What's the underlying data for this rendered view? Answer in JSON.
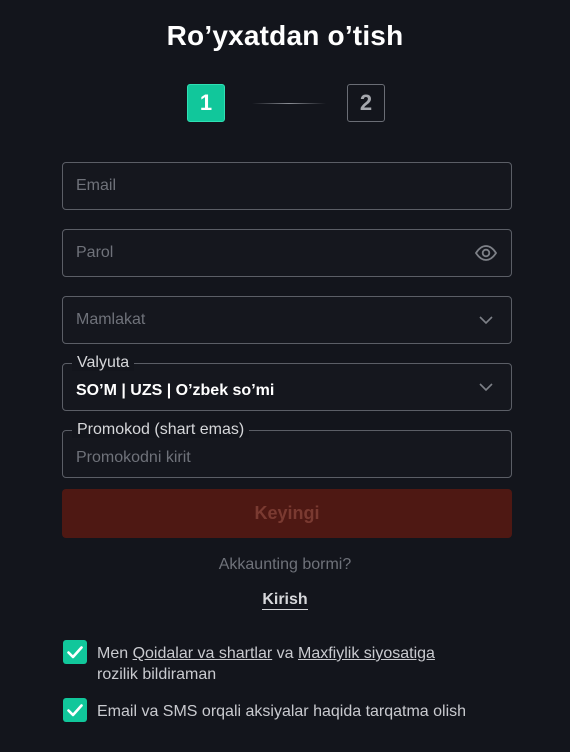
{
  "title": "Ro’yxatdan o’tish",
  "stepper": {
    "step1": "1",
    "step2": "2",
    "active_step": 1
  },
  "form": {
    "email_placeholder": "Email",
    "password_placeholder": "Parol",
    "country_placeholder": "Mamlakat",
    "currency_label": "Valyuta",
    "currency_value": "SO’M | UZS | O’zbek so’mi",
    "promo_label": "Promokod (shart emas)",
    "promo_placeholder": "Promokodni kirit"
  },
  "next_button": "Keyingi",
  "has_account_text": "Akkaunting bormi?",
  "login_link": "Kirish",
  "consents": {
    "terms": {
      "checked": true,
      "prefix": "Men ",
      "terms_link": "Qoidalar va shartlar",
      "middle": " va ",
      "privacy_link": "Maxfiylik siyosatiga",
      "suffix": "rozilik bildiraman"
    },
    "marketing": {
      "checked": true,
      "text": "Email va SMS orqali aksiyalar haqida tarqatma olish"
    }
  },
  "colors": {
    "background": "#13151c",
    "accent": "#11c79b",
    "button_disabled": "#4e1813"
  },
  "icons": {
    "password_toggle": "eye-icon",
    "dropdown": "chevron-down-icon",
    "checkbox": "checkmark-icon"
  }
}
